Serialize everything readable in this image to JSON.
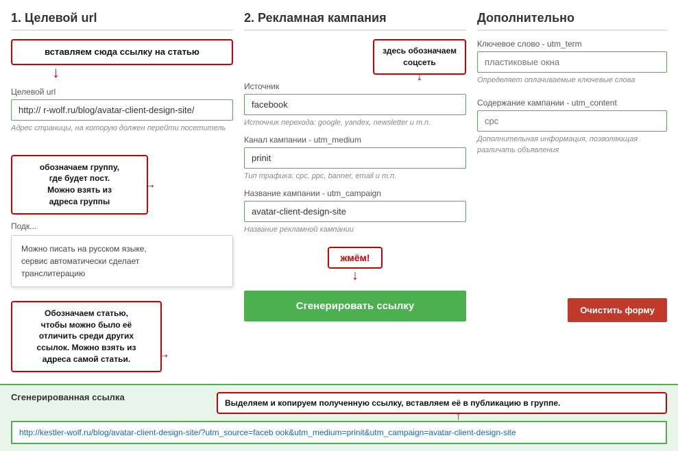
{
  "section1": {
    "title": "1. Целевой url",
    "ann_insert": "вставляем сюда ссылку на статью",
    "url_label": "Целевой url",
    "url_value": "http:// r-wolf.ru/blog/avatar-client-design-site/",
    "url_placeholder": "http://",
    "url_hint": "Адрес страницы, на которую должен перейти посетитель",
    "ann_group": "обозначаем группу,\nгде будет пост.\nМожно взять из\nадреса группы",
    "subcampaign_label": "Подк",
    "subcampaign_placeholder": "",
    "subcampaign_tooltip": "Можно писать на русском языке,\nсервис автоматически сделает\nтранслитерацию",
    "ann_article": "Обозначаем статью,\nчтобы можно было её\nотличить среди других\nссылок. Можно взять из\nадреса самой статьи."
  },
  "section2": {
    "title": "2. Рекламная кампания",
    "ann_social": "здесь обозначаем\nсоцсеть",
    "source_label": "Источни",
    "source_value": "facebook",
    "source_placeholder": "",
    "source_hint": "Источник перехода: google, yandex, newsletter и т.п.",
    "medium_label": "Канал кампании - utm_medium",
    "medium_value": "prinit",
    "medium_placeholder": "",
    "medium_hint": "Тип трафика: cpc, ppc, banner, email и т.п.",
    "campaign_label": "Название кампании - utm_campaign",
    "campaign_value": "avatar-client-design-site",
    "campaign_placeholder": "",
    "campaign_hint": "Название рекламной кампании",
    "ann_press": "жмём!",
    "generate_btn": "Сгенерировать ссылку"
  },
  "section3": {
    "title": "Дополнительно",
    "keyword_label": "Ключевое слово - utm_term",
    "keyword_value": "",
    "keyword_placeholder": "пластиковые окна",
    "keyword_hint": "Определяет оплачиваемые ключевые слова",
    "content_label": "Содержание кампании - utm_content",
    "content_value": "",
    "content_placeholder": "cpc",
    "content_hint": "Дополнительная информация, позволяющая различать объявления",
    "clear_btn": "Очистить форму"
  },
  "bottom": {
    "label": "Сгенерированная ссылка",
    "ann_copy": "Выделяем и копируем полученную ссылку, вставляем её в публикацию в группе.",
    "url": "http://kestler-wolf.ru/blog/avatar-client-design-site/?utm_source=faceb ook&utm_medium=prinit&utm_campaign=avatar-client-design-site"
  }
}
